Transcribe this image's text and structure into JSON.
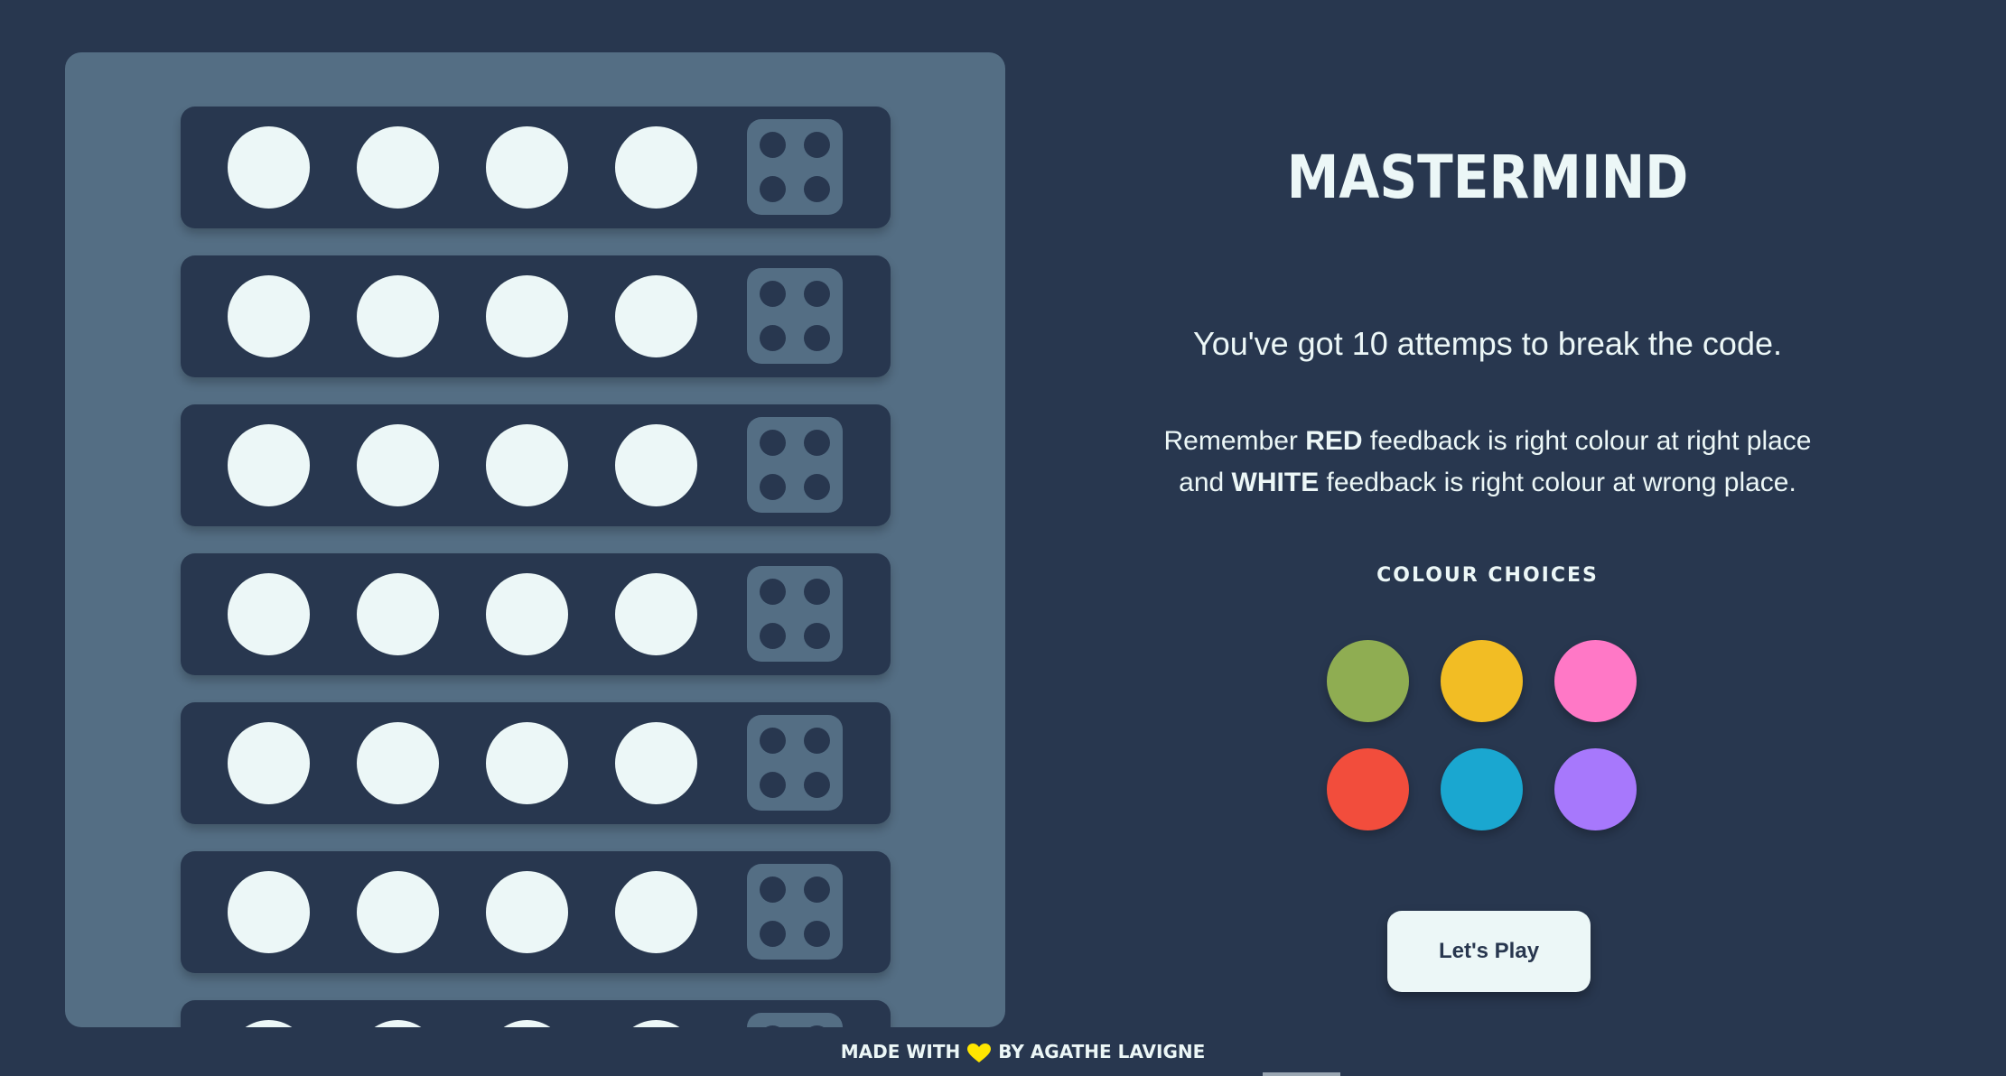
{
  "game": {
    "title": "MASTERMIND",
    "subtitle": "You've got 10 attemps to break the code.",
    "rules": {
      "line1_before": "Remember ",
      "line1_bold": "RED",
      "line1_after": " feedback is right colour at right place",
      "line2_before": "and ",
      "line2_bold": "WHITE",
      "line2_after": " feedback is right colour at wrong place."
    },
    "choices_label": "COLOUR CHOICES",
    "colour_choices": [
      {
        "name": "green",
        "color": "#8fad52"
      },
      {
        "name": "yellow",
        "color": "#f2bd24"
      },
      {
        "name": "pink",
        "color": "#ff78c6"
      },
      {
        "name": "red",
        "color": "#f24d3c"
      },
      {
        "name": "blue",
        "color": "#1aa7d0"
      },
      {
        "name": "purple",
        "color": "#a778fc"
      }
    ],
    "play_button": "Let's Play"
  },
  "board": {
    "visible_rows": 7,
    "pegs_per_row": 4,
    "feedback_pegs": 4
  },
  "footer": {
    "made_with": "MADE WITH",
    "by": "BY AGATHE LAVIGNE",
    "heart_icon": "yellow-heart-icon"
  },
  "colors": {
    "background": "#28374f",
    "board": "#546e84",
    "peg_empty": "#ecf7f7",
    "heart": "#ffe600"
  }
}
